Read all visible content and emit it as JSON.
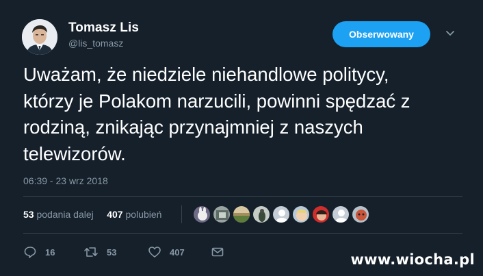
{
  "author": {
    "display_name": "Tomasz Lis",
    "username": "@lis_tomasz"
  },
  "follow_button": {
    "label": "Obserwowany"
  },
  "tweet": {
    "text_lines": [
      "Uważam, że niedziele niehandlowe politycy,",
      "którzy je Polakom narzucili, powinni spędzać z",
      "rodziną, znikając przynajmniej z naszych",
      "telewizorów."
    ],
    "timestamp": "06:39 - 23 wrz 2018"
  },
  "stats": {
    "retweets_count": "53",
    "retweets_label": "podania dalej",
    "likes_count": "407",
    "likes_label": "polubień"
  },
  "actions": {
    "reply_count": "16",
    "retweet_count": "53",
    "like_count": "407"
  },
  "colors": {
    "background": "#15202b",
    "accent": "#1da1f2",
    "muted": "#8899a6",
    "divider": "#38444d"
  },
  "watermark": "www.wiocha.pl"
}
